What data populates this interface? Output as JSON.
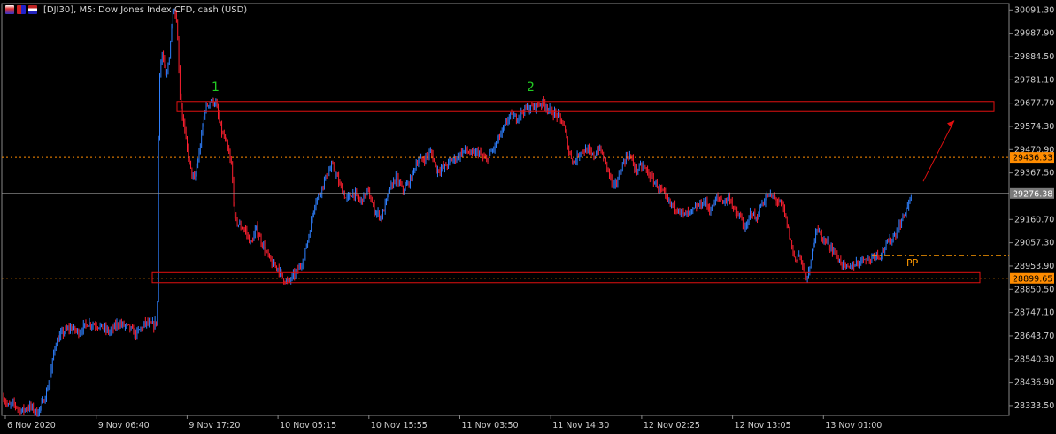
{
  "header": {
    "title": "[DJI30], M5:  Dow Jones Index CFD, cash (USD)"
  },
  "colors": {
    "background": "#000000",
    "bull": "#2f80ff",
    "bear": "#ff2030",
    "level": "#ff8c00",
    "zone": "#e01010",
    "last_price": "#606060",
    "pivot": "#ff9900",
    "text": "#cfcfcf"
  },
  "chart_data": {
    "type": "candlestick",
    "symbol": "[DJI30]",
    "timeframe": "M5",
    "title": "Dow Jones Index CFD, cash (USD)",
    "ylim": [
      28290,
      30120
    ],
    "grid": false,
    "y_ticks": [
      "30091.30",
      "29987.90",
      "29884.50",
      "29781.10",
      "29677.70",
      "29574.30",
      "29470.90",
      "29367.50",
      "29160.70",
      "29057.30",
      "28953.90",
      "28850.50",
      "28747.10",
      "28643.70",
      "28540.30",
      "28436.90",
      "28333.50"
    ],
    "x_ticks": [
      "6 Nov 2020",
      "9 Nov 06:40",
      "9 Nov 17:20",
      "10 Nov 05:15",
      "10 Nov 15:55",
      "11 Nov 03:50",
      "11 Nov 14:30",
      "12 Nov 02:25",
      "12 Nov 13:05",
      "13 Nov 01:00"
    ],
    "price_path": [
      [
        0,
        28370
      ],
      [
        5,
        28330
      ],
      [
        12,
        28340
      ],
      [
        20,
        28310
      ],
      [
        30,
        28330
      ],
      [
        38,
        28300
      ],
      [
        45,
        28350
      ],
      [
        52,
        28440
      ],
      [
        58,
        28600
      ],
      [
        65,
        28650
      ],
      [
        75,
        28680
      ],
      [
        85,
        28660
      ],
      [
        95,
        28700
      ],
      [
        108,
        28690
      ],
      [
        120,
        28660
      ],
      [
        130,
        28700
      ],
      [
        142,
        28680
      ],
      [
        150,
        28650
      ],
      [
        160,
        28700
      ],
      [
        170,
        28690
      ],
      [
        174,
        28710
      ],
      [
        176,
        29800
      ],
      [
        180,
        29900
      ],
      [
        184,
        29780
      ],
      [
        188,
        29900
      ],
      [
        192,
        30110
      ],
      [
        196,
        30050
      ],
      [
        200,
        29700
      ],
      [
        204,
        29580
      ],
      [
        208,
        29470
      ],
      [
        212,
        29380
      ],
      [
        216,
        29330
      ],
      [
        222,
        29470
      ],
      [
        228,
        29650
      ],
      [
        234,
        29690
      ],
      [
        240,
        29680
      ],
      [
        246,
        29560
      ],
      [
        252,
        29500
      ],
      [
        258,
        29400
      ],
      [
        262,
        29160
      ],
      [
        268,
        29130
      ],
      [
        274,
        29110
      ],
      [
        280,
        29050
      ],
      [
        286,
        29120
      ],
      [
        292,
        29060
      ],
      [
        298,
        29010
      ],
      [
        304,
        28960
      ],
      [
        310,
        28950
      ],
      [
        316,
        28900
      ],
      [
        322,
        28880
      ],
      [
        328,
        28910
      ],
      [
        334,
        28940
      ],
      [
        340,
        28990
      ],
      [
        346,
        29100
      ],
      [
        352,
        29230
      ],
      [
        358,
        29280
      ],
      [
        365,
        29350
      ],
      [
        372,
        29400
      ],
      [
        380,
        29320
      ],
      [
        388,
        29250
      ],
      [
        396,
        29280
      ],
      [
        404,
        29240
      ],
      [
        412,
        29290
      ],
      [
        420,
        29200
      ],
      [
        428,
        29170
      ],
      [
        436,
        29280
      ],
      [
        444,
        29350
      ],
      [
        452,
        29290
      ],
      [
        460,
        29330
      ],
      [
        468,
        29420
      ],
      [
        476,
        29430
      ],
      [
        484,
        29460
      ],
      [
        490,
        29380
      ],
      [
        498,
        29390
      ],
      [
        506,
        29420
      ],
      [
        514,
        29440
      ],
      [
        522,
        29470
      ],
      [
        530,
        29450
      ],
      [
        538,
        29460
      ],
      [
        546,
        29420
      ],
      [
        554,
        29470
      ],
      [
        560,
        29520
      ],
      [
        566,
        29560
      ],
      [
        572,
        29620
      ],
      [
        580,
        29610
      ],
      [
        590,
        29650
      ],
      [
        600,
        29660
      ],
      [
        610,
        29680
      ],
      [
        620,
        29640
      ],
      [
        628,
        29620
      ],
      [
        634,
        29580
      ],
      [
        640,
        29460
      ],
      [
        646,
        29410
      ],
      [
        652,
        29460
      ],
      [
        660,
        29470
      ],
      [
        668,
        29440
      ],
      [
        674,
        29480
      ],
      [
        680,
        29430
      ],
      [
        686,
        29360
      ],
      [
        690,
        29290
      ],
      [
        696,
        29350
      ],
      [
        702,
        29420
      ],
      [
        708,
        29450
      ],
      [
        716,
        29380
      ],
      [
        724,
        29400
      ],
      [
        732,
        29350
      ],
      [
        740,
        29310
      ],
      [
        746,
        29280
      ],
      [
        752,
        29240
      ],
      [
        758,
        29220
      ],
      [
        764,
        29210
      ],
      [
        770,
        29180
      ],
      [
        778,
        29190
      ],
      [
        786,
        29220
      ],
      [
        794,
        29240
      ],
      [
        800,
        29200
      ],
      [
        808,
        29260
      ],
      [
        816,
        29240
      ],
      [
        822,
        29260
      ],
      [
        828,
        29190
      ],
      [
        834,
        29170
      ],
      [
        840,
        29110
      ],
      [
        846,
        29200
      ],
      [
        852,
        29160
      ],
      [
        858,
        29230
      ],
      [
        866,
        29270
      ],
      [
        874,
        29250
      ],
      [
        882,
        29220
      ],
      [
        888,
        29120
      ],
      [
        892,
        29040
      ],
      [
        896,
        28980
      ],
      [
        900,
        29010
      ],
      [
        904,
        28960
      ],
      [
        908,
        28900
      ],
      [
        912,
        28920
      ],
      [
        916,
        29040
      ],
      [
        920,
        29130
      ],
      [
        926,
        29080
      ],
      [
        932,
        29060
      ],
      [
        938,
        29030
      ],
      [
        944,
        28990
      ],
      [
        950,
        28960
      ],
      [
        956,
        28940
      ],
      [
        962,
        28960
      ],
      [
        968,
        28970
      ],
      [
        974,
        28990
      ],
      [
        980,
        28980
      ],
      [
        986,
        29010
      ],
      [
        992,
        29000
      ],
      [
        998,
        29040
      ],
      [
        1004,
        29070
      ],
      [
        1010,
        29100
      ],
      [
        1016,
        29150
      ],
      [
        1022,
        29210
      ],
      [
        1028,
        29260
      ]
    ],
    "horizontal_levels": [
      {
        "price": 29436.33,
        "label": "29436.33",
        "style": "dotted",
        "color": "#ff8c00"
      },
      {
        "price": 28899.65,
        "label": "28899.65",
        "style": "dotted",
        "color": "#ff8c00"
      }
    ],
    "last_price": {
      "price": 29276.38,
      "label": "29276.38",
      "color": "#606060"
    },
    "zones": [
      {
        "label": "2",
        "price_top": 29660,
        "price_bottom": 29630,
        "x_start_frac": 0.0,
        "x_end_frac": 0.0
      },
      {
        "label": "",
        "price_top": 28920,
        "price_bottom": 28890,
        "x_start_frac": 0.0,
        "x_end_frac": 0.0
      }
    ],
    "annotations": [
      {
        "text": "1",
        "price": 29700,
        "color": "#22cc22"
      },
      {
        "text": "2",
        "price": 29700,
        "color": "#22cc22"
      }
    ],
    "pivot": {
      "text": "PP",
      "price": 29000,
      "color": "#ff9900"
    },
    "arrow": {
      "from_price": 29330,
      "to_price": 29600,
      "color": "#e01010"
    }
  }
}
